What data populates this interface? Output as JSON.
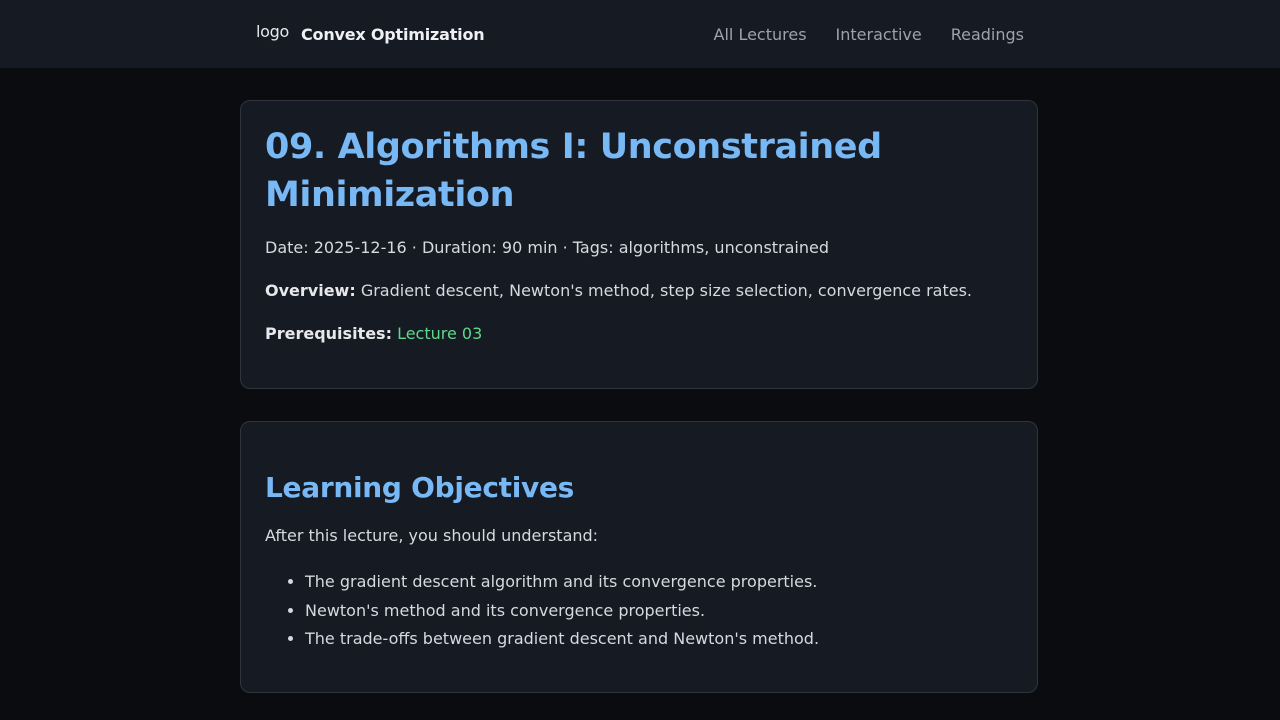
{
  "header": {
    "logo_alt": "logo",
    "site_title": "Convex Optimization",
    "nav": [
      "All Lectures",
      "Interactive",
      "Readings"
    ]
  },
  "lecture": {
    "title": "09. Algorithms I: Unconstrained Minimization",
    "meta": "Date: 2025-12-16 · Duration: 90 min · Tags: algorithms, unconstrained",
    "overview_label": "Overview:",
    "overview_text": "Gradient descent, Newton's method, step size selection, convergence rates.",
    "prereq_label": "Prerequisites:",
    "prereq_link": "Lecture 03"
  },
  "objectives": {
    "heading": "Learning Objectives",
    "intro": "After this lecture, you should understand:",
    "items": [
      "The gradient descent algorithm and its convergence properties.",
      "Newton's method and its convergence properties.",
      "The trade-offs between gradient descent and Newton's method."
    ]
  },
  "colors": {
    "background": "#0a0c10",
    "card": "#161a23",
    "heading_blue": "#78b8f5",
    "link_green": "#5fd88a"
  }
}
